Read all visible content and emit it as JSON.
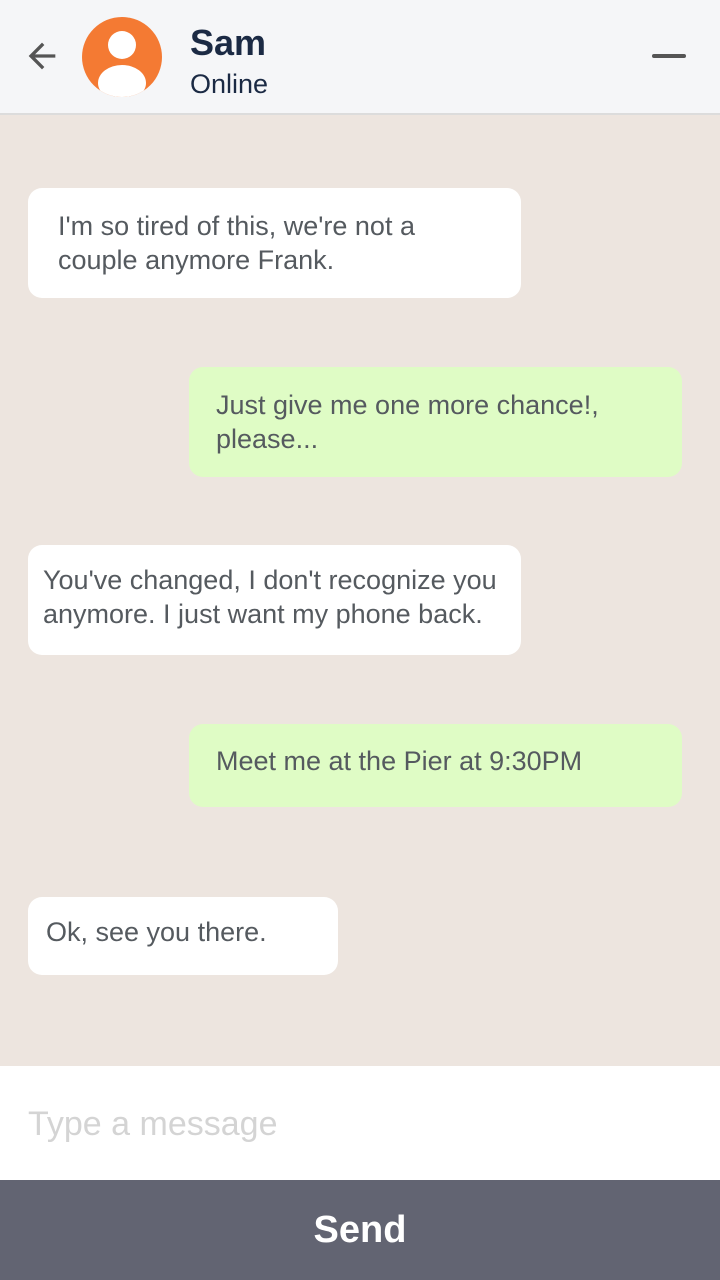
{
  "header": {
    "contact_name": "Sam",
    "contact_status": "Online",
    "back_icon": "arrow-left-icon",
    "avatar_icon": "user-avatar-icon",
    "minimize_icon": "minimize-icon",
    "avatar_color": "#f47a33"
  },
  "messages": [
    {
      "from": "them",
      "text": "I'm so tired of this, we're not a couple anymore Frank."
    },
    {
      "from": "me",
      "text": "Just give me one more chance!, please..."
    },
    {
      "from": "them",
      "text": "You've changed, I don't recognize you anymore. I just want my phone back."
    },
    {
      "from": "me",
      "text": "Meet me at the Pier at 9:30PM"
    },
    {
      "from": "them",
      "text": "Ok, see you there."
    }
  ],
  "composer": {
    "placeholder": "Type a message",
    "value": ""
  },
  "send_label": "Send",
  "colors": {
    "background": "#ede5df",
    "received_bubble": "#ffffff",
    "sent_bubble": "#dffcc5",
    "send_button": "#626472"
  }
}
